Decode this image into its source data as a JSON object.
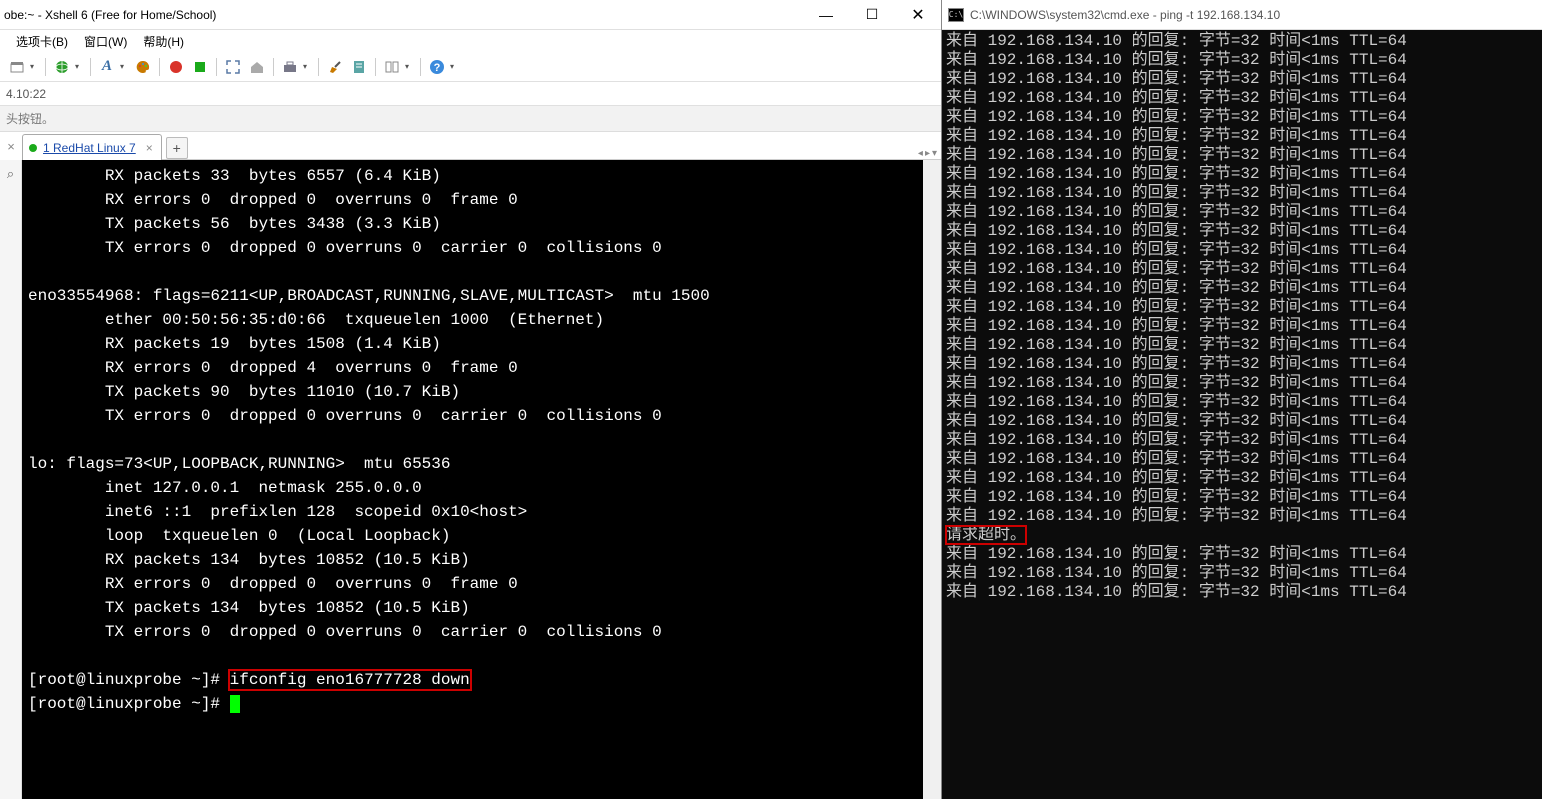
{
  "xshell": {
    "title": "obe:~ - Xshell 6 (Free for Home/School)",
    "winbtns": {
      "min": "—",
      "max": "☐",
      "close": "✕"
    },
    "menu": [
      "选项卡(B)",
      "窗口(W)",
      "帮助(H)"
    ],
    "addr": "4.10:22",
    "hint": "头按钮。",
    "tab": {
      "label": "1 RedHat Linux 7",
      "close": "×",
      "add": "+"
    },
    "sidebar_icons": {
      "close": "×",
      "search": "⌕"
    },
    "term_lines": [
      "        RX packets 33  bytes 6557 (6.4 KiB)",
      "        RX errors 0  dropped 0  overruns 0  frame 0",
      "        TX packets 56  bytes 3438 (3.3 KiB)",
      "        TX errors 0  dropped 0 overruns 0  carrier 0  collisions 0",
      "",
      "eno33554968: flags=6211<UP,BROADCAST,RUNNING,SLAVE,MULTICAST>  mtu 1500",
      "        ether 00:50:56:35:d0:66  txqueuelen 1000  (Ethernet)",
      "        RX packets 19  bytes 1508 (1.4 KiB)",
      "        RX errors 0  dropped 4  overruns 0  frame 0",
      "        TX packets 90  bytes 11010 (10.7 KiB)",
      "        TX errors 0  dropped 0 overruns 0  carrier 0  collisions 0",
      "",
      "lo: flags=73<UP,LOOPBACK,RUNNING>  mtu 65536",
      "        inet 127.0.0.1  netmask 255.0.0.0",
      "        inet6 ::1  prefixlen 128  scopeid 0x10<host>",
      "        loop  txqueuelen 0  (Local Loopback)",
      "        RX packets 134  bytes 10852 (10.5 KiB)",
      "        RX errors 0  dropped 0  overruns 0  frame 0",
      "        TX packets 134  bytes 10852 (10.5 KiB)",
      "        TX errors 0  dropped 0 overruns 0  carrier 0  collisions 0",
      ""
    ],
    "prompt1_left": "[root@linuxprobe ~]# ",
    "prompt1_cmd": "ifconfig eno16777728 down",
    "prompt2_left": "[root@linuxprobe ~]# "
  },
  "cmd": {
    "title": "C:\\WINDOWS\\system32\\cmd.exe - ping  -t 192.168.134.10",
    "icon_text": "C:\\",
    "reply_line": "来自 192.168.134.10 的回复: 字节=32 时间<1ms TTL=64",
    "timeout": "请求超时。",
    "pre_count": 26,
    "post_count": 3
  },
  "icons": {
    "globe": "#2a9d2a",
    "font": "#3a6ea5",
    "palette": "#c97a00",
    "play": "#d9332a",
    "stop": "#1aaa1a",
    "expand": "#5a7aa5",
    "home": "#8a8a8a",
    "box": "#778",
    "brush": "#c97a00",
    "notes": "#5aa5a5",
    "split": "#888",
    "help": "#3a8adc"
  }
}
